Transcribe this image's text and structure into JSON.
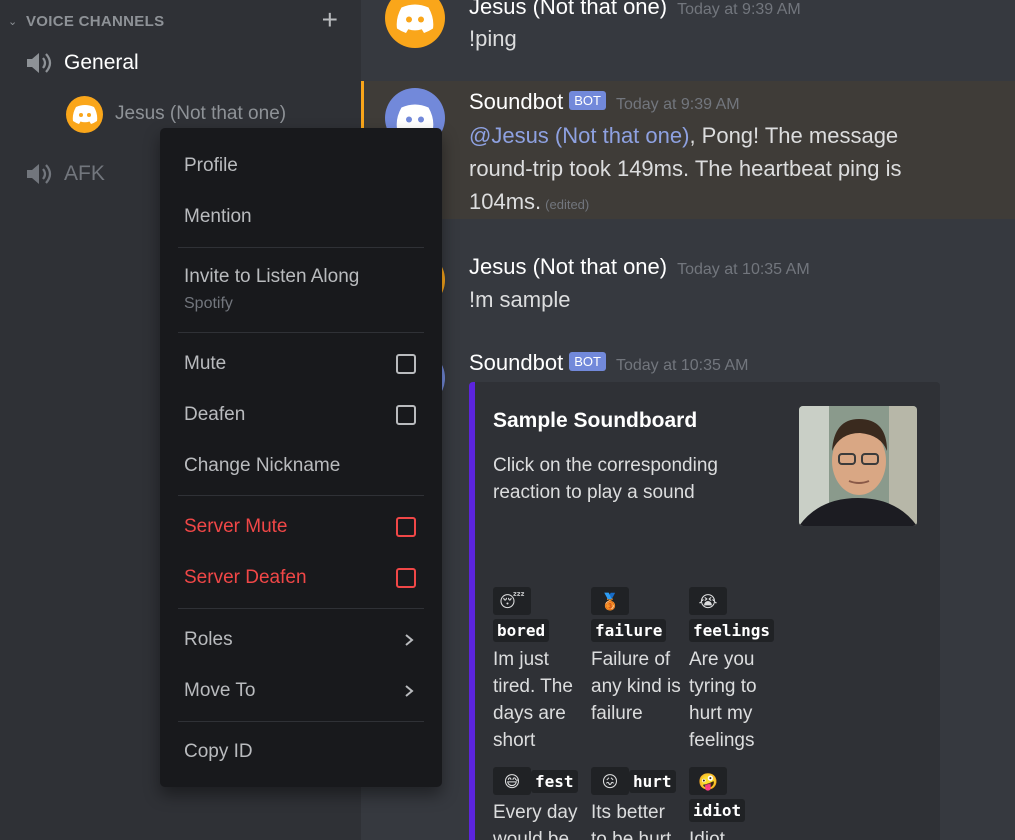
{
  "sidebar": {
    "section_title": "VOICE CHANNELS",
    "channels": [
      {
        "name": "General"
      },
      {
        "name": "AFK"
      }
    ],
    "member": {
      "name": "Jesus (Not that one)"
    }
  },
  "context_menu": {
    "profile": "Profile",
    "mention": "Mention",
    "invite": "Invite to Listen Along",
    "invite_sub": "Spotify",
    "mute": "Mute",
    "deafen": "Deafen",
    "change_nickname": "Change Nickname",
    "server_mute": "Server Mute",
    "server_deafen": "Server Deafen",
    "roles": "Roles",
    "move_to": "Move To",
    "copy_id": "Copy ID"
  },
  "messages": [
    {
      "author": "Jesus (Not that one)",
      "timestamp": "Today at 9:39 AM",
      "text": "!ping"
    },
    {
      "author": "Soundbot",
      "badge": "BOT",
      "timestamp": "Today at 9:39 AM",
      "mention": "@Jesus (Not that one)",
      "text": ", Pong! The message round-trip took 149ms. The heartbeat ping is 104ms.",
      "edited": "(edited)"
    },
    {
      "author": "Jesus (Not that one)",
      "timestamp": "Today at 10:35 AM",
      "text": "!m sample"
    },
    {
      "author": "Soundbot",
      "badge": "BOT",
      "timestamp": "Today at 10:35 AM"
    }
  ],
  "embed": {
    "title": "Sample Soundboard",
    "description": "Click on the corresponding reaction to play a sound",
    "fields": [
      {
        "name": "bored",
        "desc": "Im just tired. The days are short",
        "emoji": "yawn-emoji"
      },
      {
        "name": "failure",
        "desc": "Failure of any kind is failure",
        "emoji": "bronze-medal-emoji"
      },
      {
        "name": "feelings",
        "desc": "Are you tyring to hurt my feelings",
        "emoji": "crying-emoji"
      },
      {
        "name": "fest",
        "desc": "Every day would be",
        "emoji": "sweat-smile-emoji"
      },
      {
        "name": "hurt",
        "desc": "Its better to be hurt",
        "emoji": "confounded-emoji"
      },
      {
        "name": "idiot",
        "desc": "Idiot",
        "emoji": "zany-emoji"
      }
    ]
  },
  "colors": {
    "accent": "#7289da",
    "embed_bar": "#5c24de",
    "danger": "#f04747",
    "avatar_orange": "#faa61a"
  }
}
